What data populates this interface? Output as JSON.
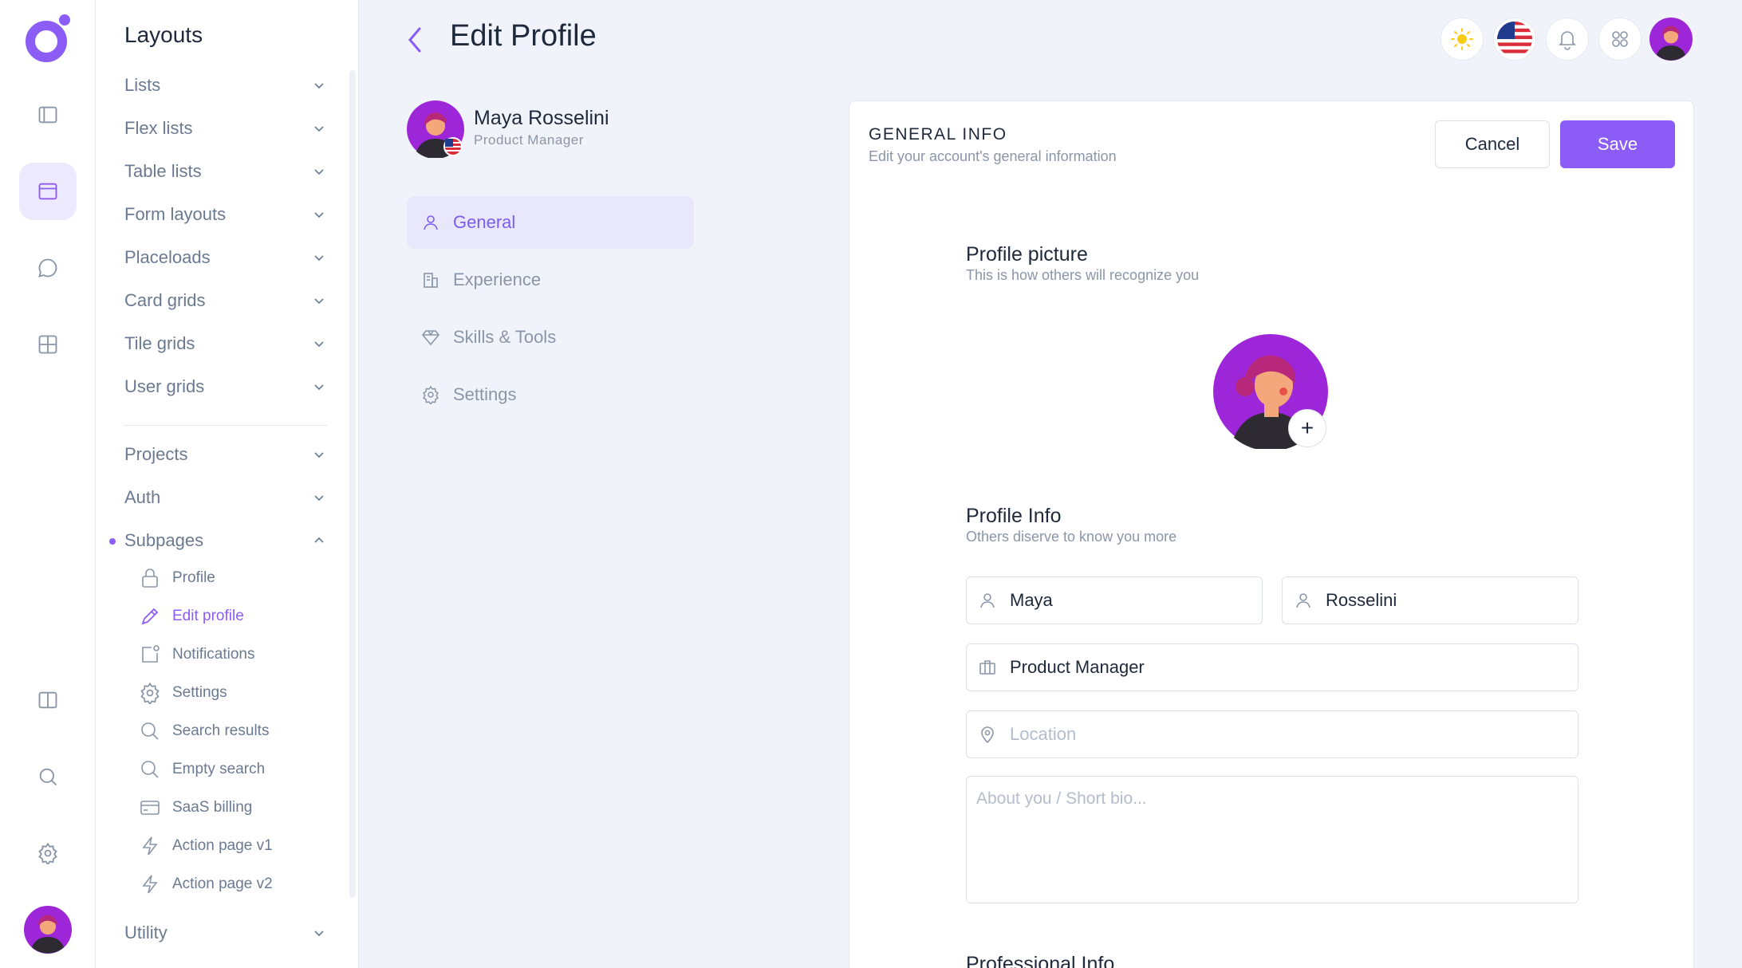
{
  "app": {
    "accent": "#8b5cf6"
  },
  "menu": {
    "title": "Layouts",
    "items": [
      {
        "label": "Lists"
      },
      {
        "label": "Flex lists"
      },
      {
        "label": "Table lists"
      },
      {
        "label": "Form layouts"
      },
      {
        "label": "Placeloads"
      },
      {
        "label": "Card grids"
      },
      {
        "label": "Tile grids"
      },
      {
        "label": "User grids"
      },
      {
        "label": "Projects"
      },
      {
        "label": "Auth"
      },
      {
        "label": "Subpages"
      },
      {
        "label": "Utility"
      }
    ],
    "subpages": [
      {
        "label": "Profile",
        "icon": "lock-icon"
      },
      {
        "label": "Edit profile",
        "icon": "pencil-icon"
      },
      {
        "label": "Notifications",
        "icon": "notification-icon"
      },
      {
        "label": "Settings",
        "icon": "gear-icon"
      },
      {
        "label": "Search results",
        "icon": "search-icon"
      },
      {
        "label": "Empty search",
        "icon": "search-icon"
      },
      {
        "label": "SaaS billing",
        "icon": "credit-card-icon"
      },
      {
        "label": "Action page v1",
        "icon": "lightning-icon"
      },
      {
        "label": "Action page v2",
        "icon": "lightning-icon"
      }
    ]
  },
  "header": {
    "title": "Edit Profile"
  },
  "profile": {
    "name": "Maya Rosselini",
    "role": "Product Manager",
    "tabs": [
      {
        "label": "General",
        "icon": "user-icon"
      },
      {
        "label": "Experience",
        "icon": "building-icon"
      },
      {
        "label": "Skills & Tools",
        "icon": "diamond-icon"
      },
      {
        "label": "Settings",
        "icon": "gear-icon"
      }
    ]
  },
  "card": {
    "title": "GENERAL INFO",
    "subtitle": "Edit your account's general information",
    "cancel": "Cancel",
    "save": "Save",
    "picture": {
      "title": "Profile picture",
      "subtitle": "This is how others will recognize you",
      "add": "+"
    },
    "info": {
      "title": "Profile Info",
      "subtitle": "Others diserve to know you more"
    },
    "fields": {
      "first_name": "Maya",
      "last_name": "Rosselini",
      "job_title": "Product Manager",
      "location_placeholder": "Location",
      "bio_placeholder": "About you / Short bio..."
    },
    "professional_title": "Professional Info"
  }
}
